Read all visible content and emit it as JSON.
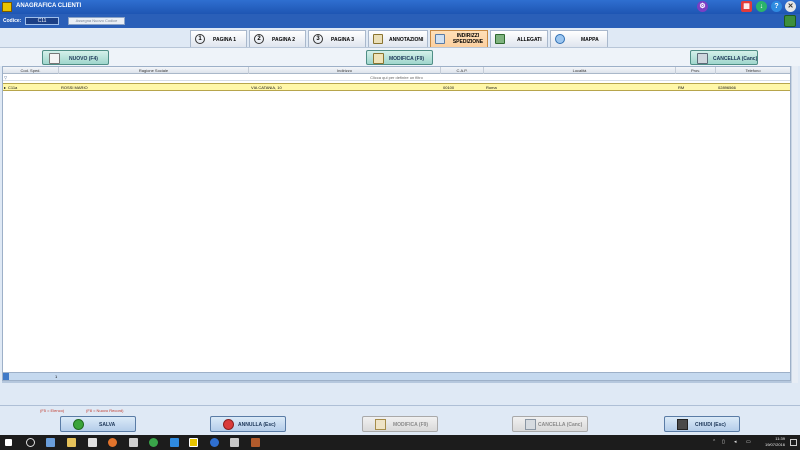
{
  "window": {
    "title": "ANAGRAFICA CLIENTI",
    "controls": [
      "gear-icon",
      "calculator-icon",
      "download-icon",
      "help-icon",
      "close-icon"
    ],
    "accent": "#2a5fb8"
  },
  "codice": {
    "label": "Codice:",
    "value": "C11",
    "assign_button": "Assegna Nuovo Codice"
  },
  "tabs": [
    {
      "label": "PAGINA 1",
      "icon": "1"
    },
    {
      "label": "PAGINA 2",
      "icon": "2"
    },
    {
      "label": "PAGINA 3",
      "icon": "3"
    },
    {
      "label": "ANNOTAZIONI",
      "icon": "notes-icon"
    },
    {
      "label": "INDIRIZZI SPEDIZIONE",
      "icon": "shipping-icon",
      "active": true
    },
    {
      "label": "ALLEGATI",
      "icon": "attach-icon"
    },
    {
      "label": "MAPPA",
      "icon": "map-icon"
    }
  ],
  "actions": {
    "new_label": "NUOVO (F4)",
    "edit_label": "MODIFICA (F9)",
    "delete_label": "CANCELLA (Canc)"
  },
  "grid": {
    "columns": [
      "Cod. Sped.",
      "Ragione Sociale",
      "Indirizzo",
      "C.A.P.",
      "Località",
      "Prov.",
      "Telefono"
    ],
    "filter_text": "Clicca qui per definire un filtro",
    "rows": [
      {
        "cod": "C11a",
        "ragione": "ROSSI MARIO",
        "indirizzo": "VIA CATANIA, 10",
        "cap": "00100",
        "localita": "Roma",
        "prov": "RM",
        "telefono": "02896566"
      }
    ],
    "footer_count": "1"
  },
  "bottom": {
    "hint_f5": "(F5 = Elenco)",
    "hint_f8": "(F8 = Nuovo Record)",
    "save_label": "SALVA",
    "cancel_label": "ANNULLA (Esc)",
    "edit_label": "MODIFICA (F9)",
    "delete_label": "CANCELLA (Canc)",
    "close_label": "CHIUDI (Esc)"
  },
  "taskbar": {
    "time": "11:39",
    "date": "19/07/2016"
  }
}
